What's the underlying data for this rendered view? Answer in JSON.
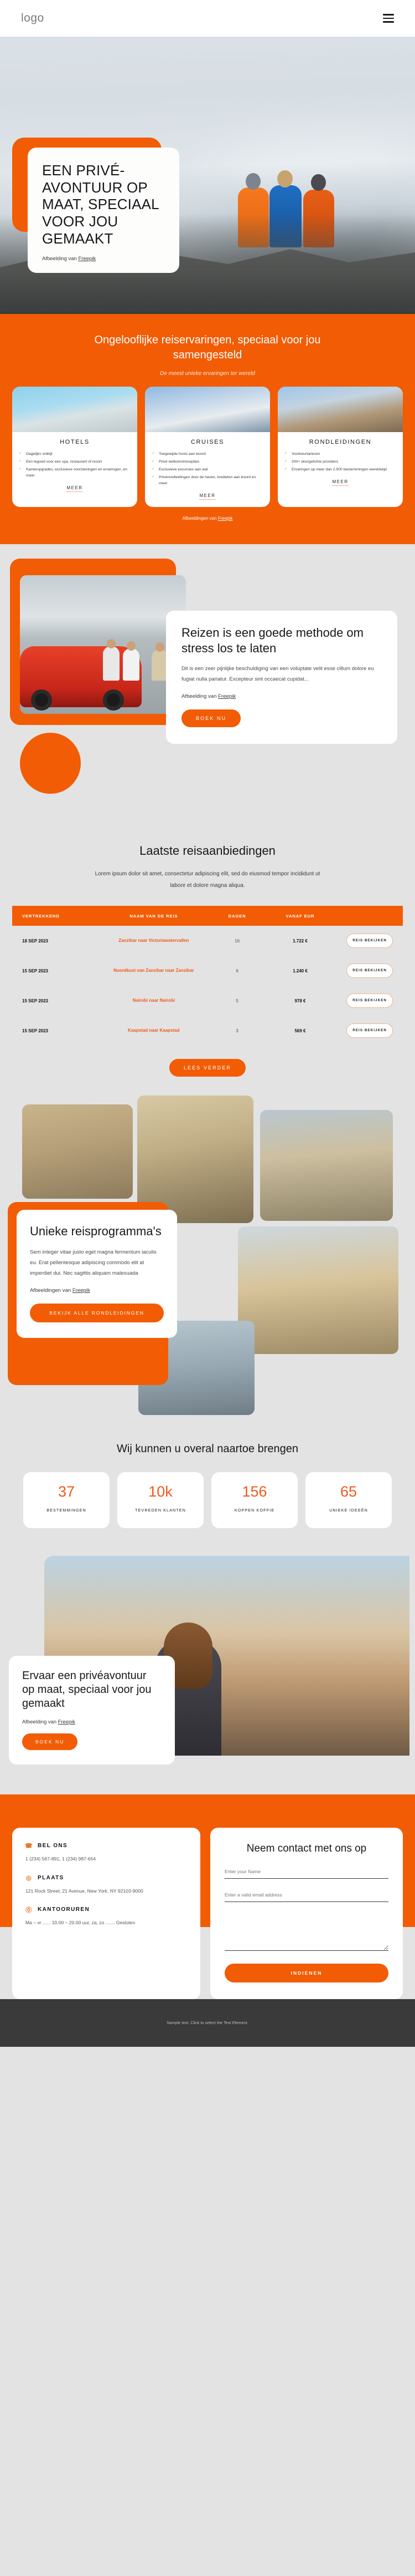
{
  "header": {
    "logo": "logo",
    "menu_icon": "hamburger-menu-icon"
  },
  "hero": {
    "title": "EEN PRIVÉ-AVONTUUR OP MAAT, SPECIAAL VOOR JOU GEMAAKT",
    "credit_prefix": "Afbeelding van ",
    "credit_link": "Freepik"
  },
  "services": {
    "heading": "Ongelooflijke reiservaringen, speciaal voor jou samengesteld",
    "subheading": "De meest unieke ervaringen ter wereld",
    "credit_prefix": "Afbeeldingen van ",
    "credit_link": "Freepik",
    "cards": [
      {
        "title": "HOTELS",
        "items": [
          "Dagelijks ontbijt",
          "Een tegoed voor een spa, restaurant of resort",
          "Kamerupgrades, exclusieve voorzieningen en ervaringen, en meer"
        ],
        "link": "MEER"
      },
      {
        "title": "CRUISES",
        "items": [
          "Toegewijde hosts aan boord",
          "Privé welkomstrecepties",
          "Exclusieve excursies aan wal",
          "Privérondleidingen door de haven, kredieten aan boord en meer"
        ],
        "link": "MEER"
      },
      {
        "title": "RONDLEIDINGEN",
        "items": [
          "Voorkeurtarieven",
          "200+ doorgelichte providers",
          "Ervaringen op meer dan 2.500 bestemmingen wereldwijd"
        ],
        "link": "MEER"
      }
    ]
  },
  "travel": {
    "title": "Reizen is een goede methode om stress los te laten",
    "body": "Dit is een zeer pijnlijke beschuldiging van een voluptate velit esse cillum dolore eu fugiat nulla pariatur. Excepteur sint occaecat cupidat...",
    "credit_prefix": "Afbeelding van ",
    "credit_link": "Freepik",
    "button": "BOEK NU"
  },
  "deals": {
    "heading": "Laatste reisaanbiedingen",
    "lead": "Lorem ipsum dolor sit amet, consectetur adipiscing elit, sed do eiusmod tempor incididunt ut labore et dolore magna aliqua.",
    "columns": [
      "VERTREKKEND",
      "NAAM VAN DE REIS",
      "DAGEN",
      "VANAF EUR",
      ""
    ],
    "rows": [
      {
        "date": "18 SEP 2023",
        "name": "Zanzibar naar Victoriawatervallen",
        "days": "16",
        "price": "1.722 €",
        "action": "REIS BEKIJKEN"
      },
      {
        "date": "15 SEP 2023",
        "name": "Noordkust van Zanzibar naar Zanzibar",
        "days": "6",
        "price": "1.240 €",
        "action": "REIS BEKIJKEN"
      },
      {
        "date": "15 SEP 2023",
        "name": "Nairobi naar Nairobi",
        "days": "5",
        "price": "978 €",
        "action": "REIS BEKIJKEN"
      },
      {
        "date": "15 SEP 2023",
        "name": "Kaapstad naar Kaapstad",
        "days": "3",
        "price": "569 €",
        "action": "REIS BEKIJKEN"
      }
    ],
    "button": "LEES VERDER"
  },
  "programs": {
    "title": "Unieke reisprogramma's",
    "body": "Sem integer vitae justo eget magna fermentum iaculis eu. Erat pellentesque adipiscing commodo elit at imperdiet dui. Nec sagittis aliquam malesuada",
    "credit_prefix": "Afbeeldingen van ",
    "credit_link": "Freepik",
    "button": "BEKIJK ALLE RONDLEIDINGEN"
  },
  "stats": {
    "heading": "Wij kunnen u overal naartoe brengen",
    "items": [
      {
        "number": "37",
        "label": "BESTEMMINGEN"
      },
      {
        "number": "10k",
        "label": "TEVREDEN KLANTEN"
      },
      {
        "number": "156",
        "label": "KOPPEN KOFFIE"
      },
      {
        "number": "65",
        "label": "UNIEKE IDEEËN"
      }
    ]
  },
  "experience": {
    "title": "Ervaar een privéavontuur op maat, speciaal voor jou gemaakt",
    "credit_prefix": "Afbeelding van ",
    "credit_link": "Freepik",
    "button": "BOEK NU"
  },
  "contact": {
    "blocks": [
      {
        "icon": "phone-icon",
        "title": "BEL ONS",
        "text": "1 (234) 567-891, 1 (234) 987-654"
      },
      {
        "icon": "location-icon",
        "title": "PLAATS",
        "text": "121 Rock Street, 21 Avenue, New York, NY 92103-9000"
      },
      {
        "icon": "clock-24-icon",
        "title": "KANTOORUREN",
        "text": "Ma – vr ...... 10.00 – 20.00 uur, za, zo ....... Gesloten"
      }
    ],
    "form": {
      "heading": "Neem contact met ons op",
      "name_placeholder": "Enter your Name",
      "email_placeholder": "Enter a valid email address",
      "message_placeholder": "",
      "submit": "INDIENEN"
    }
  },
  "footer": {
    "text": "Sample text. Click to select the Text Element."
  },
  "colors": {
    "accent": "#f25c05",
    "accent_text": "#f0591e",
    "bg": "#e3e3e3",
    "footer_bg": "#3a3a3a"
  }
}
